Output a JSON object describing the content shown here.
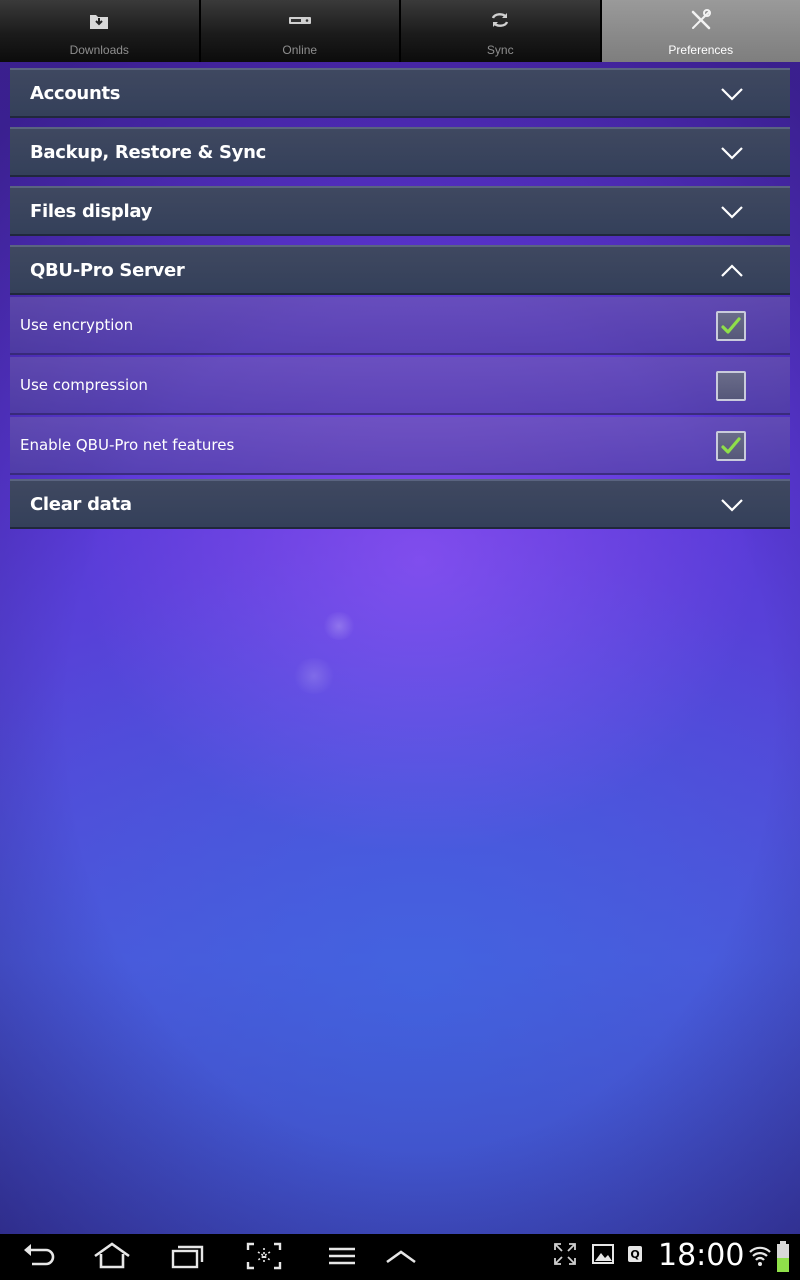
{
  "tabs": [
    {
      "label": "Downloads",
      "icon": "download-icon",
      "active": false
    },
    {
      "label": "Online",
      "icon": "server-icon",
      "active": false
    },
    {
      "label": "Sync",
      "icon": "sync-icon",
      "active": false
    },
    {
      "label": "Preferences",
      "icon": "tools-icon",
      "active": true
    }
  ],
  "sections": {
    "accounts": {
      "title": "Accounts",
      "expanded": false
    },
    "backup": {
      "title": "Backup, Restore & Sync",
      "expanded": false
    },
    "files": {
      "title": "Files display",
      "expanded": false
    },
    "server": {
      "title": "QBU-Pro Server",
      "expanded": true,
      "options": [
        {
          "label": "Use encryption",
          "checked": true
        },
        {
          "label": "Use compression",
          "checked": false
        },
        {
          "label": "Enable QBU-Pro net features",
          "checked": true
        }
      ]
    },
    "clear": {
      "title": "Clear data",
      "expanded": false
    }
  },
  "statusbar": {
    "time": "18:00",
    "nav_icons": [
      "back-icon",
      "home-icon",
      "recent-apps-icon",
      "screenshot-icon",
      "menu-icon",
      "up-icon"
    ],
    "status_icons": [
      "fullscreen-icon",
      "gallery-icon",
      "app-notification-icon",
      "wifi-icon",
      "battery-icon"
    ]
  },
  "colors": {
    "checkmark": "#8fe04a",
    "active_tab": "#8a8a8a",
    "section_header": "#3a4560"
  }
}
